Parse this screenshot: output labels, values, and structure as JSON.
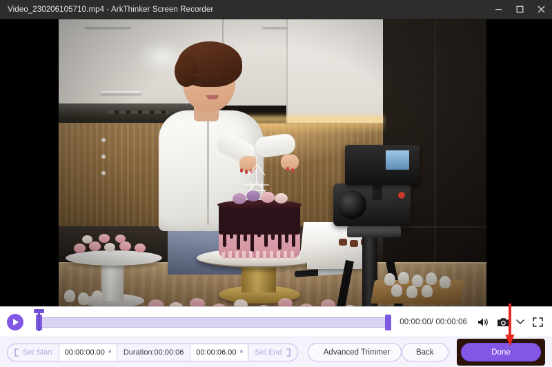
{
  "window": {
    "title": "Video_230206105710.mp4  -  ArkThinker Screen Recorder",
    "file_name": "Video_230206105710.mp4",
    "app_name": "ArkThinker Screen Recorder",
    "minimize_label": "Minimize",
    "maximize_label": "Maximize",
    "close_label": "Close"
  },
  "player": {
    "play_label": "Play",
    "time_display": "00:00:00/ 00:00:06",
    "current_time": "00:00:00",
    "total_time": "00:00:06",
    "progress_percent": 0,
    "icons": {
      "volume": "volume-icon",
      "snapshot": "camera-icon",
      "snapshot_menu": "chevron-down-icon",
      "fullscreen": "fullscreen-icon"
    }
  },
  "trimmer": {
    "set_start_label": "Set Start",
    "start_value": "00:00:00.00",
    "duration_label": "Duration:00:00:06",
    "end_value": "00:00:06.00",
    "set_end_label": "Set End",
    "advanced_trimmer_label": "Advanced Trimmer"
  },
  "actions": {
    "back_label": "Back",
    "done_label": "Done"
  },
  "annotation": {
    "arrow_color": "#e8281e",
    "highlight_color": "#2a1208",
    "target": "done-button"
  },
  "theme": {
    "accent": "#8257e6",
    "track_fill": "#d9d4f2",
    "toolbar_bg": "#f4f2fb",
    "titlebar_bg": "#2d2d2d"
  },
  "video": {
    "description": "Female pastry chef in white chef coat decorating a pink drip cake on a gold cake stand in a kitchen, with a camera on a tripod filming"
  }
}
